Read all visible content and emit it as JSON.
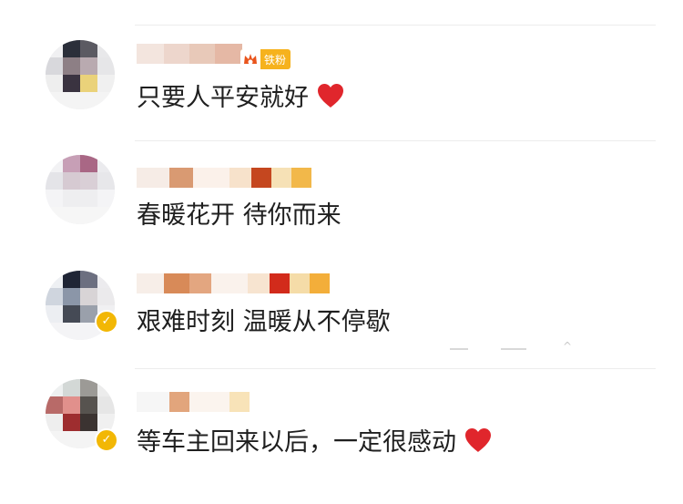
{
  "comments": [
    {
      "text": "只要人平安就好",
      "has_heart": true,
      "has_fan_badge": true,
      "fan_badge_label": "铁粉",
      "verified": true
    },
    {
      "text": "春暖花开 待你而来",
      "has_heart": false,
      "has_fan_badge": false,
      "verified": false
    },
    {
      "text": "艰难时刻 温暖从不停歇",
      "has_heart": false,
      "has_fan_badge": false,
      "verified": true
    },
    {
      "text": "等车主回来以后，一定很感动",
      "has_heart": true,
      "has_fan_badge": false,
      "verified": true
    }
  ],
  "icons": {
    "heart": "heart-icon",
    "verified": "verified-badge-icon",
    "fan": "fan-crown-icon"
  },
  "colors": {
    "heart": "#e0262c",
    "verified": "#f2b705",
    "fan_badge": "#f6b21d",
    "text": "#1f1f1f",
    "divider": "#ececec"
  }
}
